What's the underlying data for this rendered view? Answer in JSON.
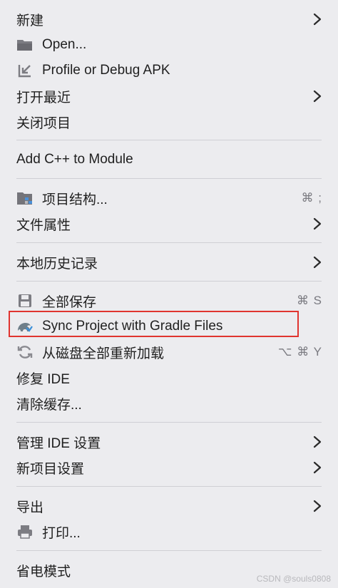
{
  "menu": {
    "new": {
      "label": "新建"
    },
    "open": {
      "label": "Open...",
      "icon": "folder-icon"
    },
    "profile": {
      "label": "Profile or Debug APK",
      "icon": "import-arrow-icon"
    },
    "recent": {
      "label": "打开最近"
    },
    "close_project": {
      "label": "关闭项目"
    },
    "add_cpp": {
      "label": "Add C++ to Module"
    },
    "project_structure": {
      "label": "项目结构...",
      "icon": "project-structure-icon",
      "shortcut": "⌘ ;"
    },
    "file_properties": {
      "label": "文件属性"
    },
    "local_history": {
      "label": "本地历史记录"
    },
    "save_all": {
      "label": "全部保存",
      "icon": "save-icon",
      "shortcut": "⌘ S"
    },
    "sync_gradle": {
      "label": "Sync Project with Gradle Files",
      "icon": "gradle-sync-icon"
    },
    "reload_disk": {
      "label": "从磁盘全部重新加载",
      "icon": "refresh-icon",
      "shortcut": "⌥ ⌘ Y"
    },
    "repair_ide": {
      "label": "修复 IDE"
    },
    "clear_cache": {
      "label": "清除缓存..."
    },
    "manage_ide_settings": {
      "label": "管理 IDE 设置"
    },
    "new_project_settings": {
      "label": "新项目设置"
    },
    "export": {
      "label": "导出"
    },
    "print": {
      "label": "打印...",
      "icon": "printer-icon"
    },
    "power_save": {
      "label": "省电模式"
    }
  },
  "watermark": "CSDN @souls0808",
  "colors": {
    "highlight_border": "#e0342f",
    "background": "#ececef",
    "separator": "#cfcfd4"
  }
}
